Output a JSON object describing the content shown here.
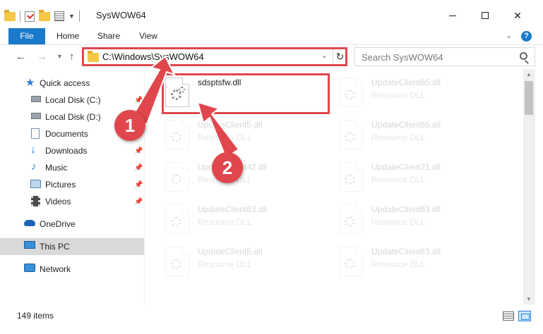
{
  "window": {
    "title": "SysWOW64",
    "controls": {
      "minimize": "minimize",
      "maximize": "maximize",
      "close": "✕"
    }
  },
  "ribbon": {
    "tabs": [
      "File",
      "Home",
      "Share",
      "View"
    ],
    "help": "?"
  },
  "address_bar": {
    "path": "C:\\Windows\\SysWOW64",
    "highlighted": true
  },
  "search": {
    "placeholder": "Search SysWOW64"
  },
  "sidebar": {
    "items": [
      {
        "label": "Quick access",
        "icon": "star-icon",
        "pinned": false
      },
      {
        "label": "Local Disk (C:)",
        "icon": "drive-icon",
        "pinned": true
      },
      {
        "label": "Local Disk (D:)",
        "icon": "drive-icon",
        "pinned": false
      },
      {
        "label": "Documents",
        "icon": "documents-icon",
        "pinned": true
      },
      {
        "label": "Downloads",
        "icon": "download-icon",
        "pinned": true
      },
      {
        "label": "Music",
        "icon": "music-icon",
        "pinned": true
      },
      {
        "label": "Pictures",
        "icon": "pictures-icon",
        "pinned": true
      },
      {
        "label": "Videos",
        "icon": "videos-icon",
        "pinned": true
      },
      {
        "label": "OneDrive",
        "icon": "cloud-icon",
        "pinned": false
      },
      {
        "label": "This PC",
        "icon": "computer-icon",
        "pinned": false,
        "selected": true
      },
      {
        "label": "Network",
        "icon": "network-icon",
        "pinned": false
      }
    ]
  },
  "files": [
    {
      "name": "sdsptsfw.dll",
      "type": "",
      "highlighted": true
    },
    {
      "name": "UpdateClient65.dll",
      "type": "Resource DLL",
      "faded": true
    },
    {
      "name": "UpdateClient5.dll",
      "type": "Resource DLL",
      "faded": true
    },
    {
      "name": "UpdateClient65.dll",
      "type": "Resource DLL",
      "faded": true
    },
    {
      "name": "UpdateClient42.dll",
      "type": "Resource DLL",
      "faded": true
    },
    {
      "name": "UpdateClient21.dll",
      "type": "Resource DLL",
      "faded": true
    },
    {
      "name": "UpdateClient63.dll",
      "type": "Resource DLL",
      "faded": true
    },
    {
      "name": "UpdateClient63.dll",
      "type": "Resource DLL",
      "faded": true
    },
    {
      "name": "UpdateClient5.dll",
      "type": "Resource DLL",
      "faded": true
    },
    {
      "name": "UpdateClient63.dll",
      "type": "Resource DLL",
      "faded": true
    }
  ],
  "status": {
    "item_count": "149 items"
  },
  "annotations": {
    "badge1": "1",
    "badge2": "2",
    "color": "#e0474c"
  },
  "colors": {
    "accent": "#1979ca",
    "highlight": "#e0474c",
    "selected_bg": "#cce8ff"
  }
}
